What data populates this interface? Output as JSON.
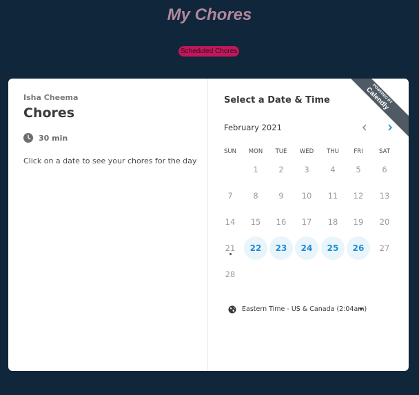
{
  "app": {
    "title": "My Chores",
    "tab_label": "Scheduled Chores"
  },
  "event": {
    "host": "Isha Cheema",
    "name": "Chores",
    "duration": "30 min",
    "description": "Click on a date to see your chores for the day"
  },
  "scheduler": {
    "heading": "Select a Date & Time",
    "branding": {
      "line1": "POWERED BY",
      "line2": "Calendly"
    },
    "month": "February 2021",
    "weekdays": [
      "SUN",
      "MON",
      "TUE",
      "WED",
      "THU",
      "FRI",
      "SAT"
    ],
    "weeks": [
      [
        "",
        "1",
        "2",
        "3",
        "4",
        "5",
        "6"
      ],
      [
        "7",
        "8",
        "9",
        "10",
        "11",
        "12",
        "13"
      ],
      [
        "14",
        "15",
        "16",
        "17",
        "18",
        "19",
        "20"
      ],
      [
        "21",
        "22",
        "23",
        "24",
        "25",
        "26",
        "27"
      ],
      [
        "28",
        "",
        "",
        "",
        "",
        "",
        ""
      ]
    ],
    "available_days": [
      "22",
      "23",
      "24",
      "25",
      "26"
    ],
    "today": "21",
    "timezone": "Eastern Time - US & Canada (2:04am)"
  },
  "colors": {
    "background": "#10263a",
    "title": "#b0879e",
    "tab_pill": "#c2185b",
    "accent": "#1a8fd6",
    "available_bg": "#eaf4fb",
    "ribbon": "#505a64"
  },
  "icons": {
    "clock": "clock-icon",
    "prev": "chevron-left-icon",
    "next": "chevron-right-icon",
    "globe": "globe-icon",
    "caret": "caret-down-icon"
  }
}
